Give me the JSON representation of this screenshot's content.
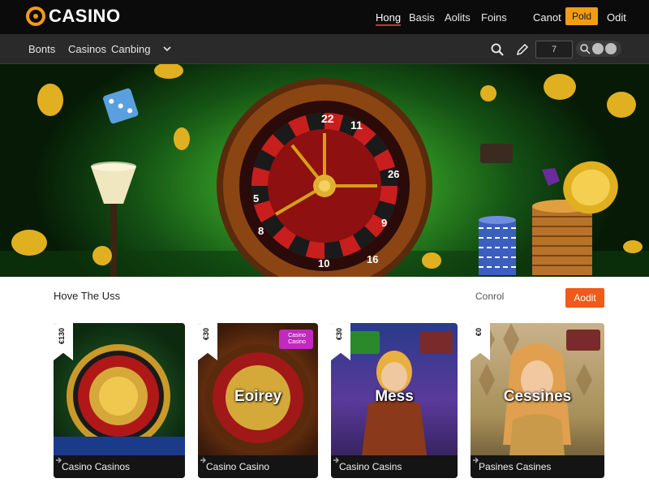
{
  "brand": {
    "logo_text": "CASINO",
    "accent": "#f39c12"
  },
  "topnav": {
    "items": [
      {
        "label": "Hong"
      },
      {
        "label": "Basis"
      },
      {
        "label": "Aolits"
      },
      {
        "label": "Foins"
      }
    ],
    "cancel_label": "Canot",
    "primary_label": "Pold",
    "right_label": "Odit"
  },
  "subnav": {
    "items": [
      {
        "label": "Bonts"
      },
      {
        "label": "Casinos"
      },
      {
        "label": "Canbing"
      }
    ],
    "search_value": "7",
    "icons": [
      "search-icon",
      "edit-icon",
      "chevron-down-icon"
    ]
  },
  "hero": {
    "wheel_numbers": [
      "22",
      "11",
      "5",
      "8",
      "10",
      "9",
      "26",
      "16"
    ]
  },
  "section": {
    "title": "Hove The Uss",
    "link_label": "Conrol",
    "button_label": "Aodit"
  },
  "cards": [
    {
      "tag": "€130",
      "art_title": "",
      "label": "Casino Casinos"
    },
    {
      "tag": "€30",
      "art_title": "Eoirey",
      "badge": "Casino Casino",
      "label": "Casino Casino"
    },
    {
      "tag": "€30",
      "art_title": "Mess",
      "label": "Casino Casins"
    },
    {
      "tag": "€0",
      "art_title": "Cessines",
      "label": "Pasines Casines"
    }
  ]
}
